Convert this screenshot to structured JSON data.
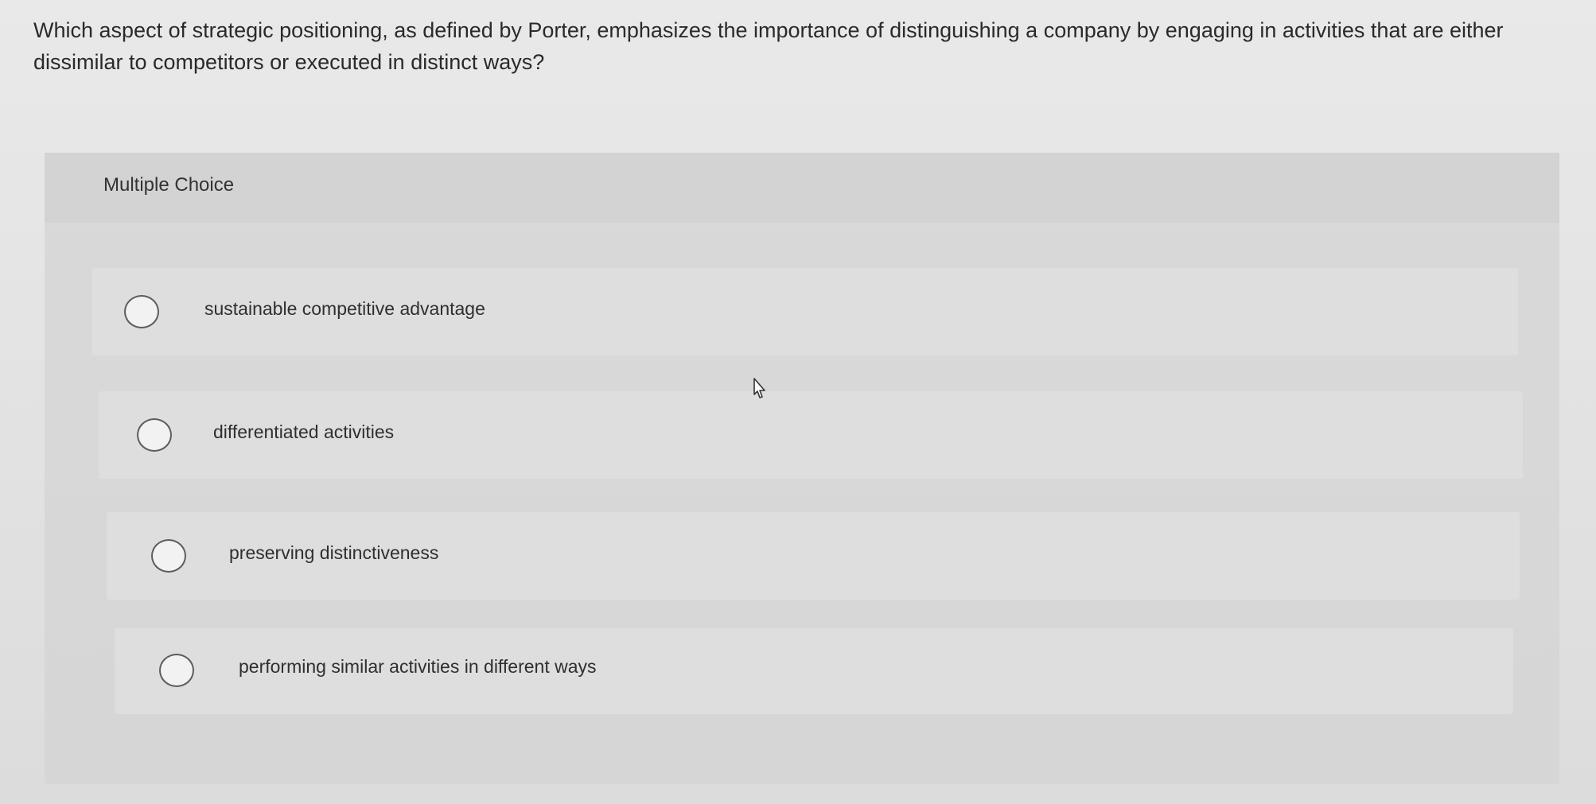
{
  "question": {
    "text": "Which aspect of strategic positioning, as defined by Porter, emphasizes the importance of distinguishing a company by engaging in activities that are either dissimilar to competitors or executed in distinct ways?"
  },
  "multiple_choice": {
    "label": "Multiple Choice",
    "options": [
      {
        "label": "sustainable competitive advantage",
        "selected": false
      },
      {
        "label": "differentiated activities",
        "selected": false
      },
      {
        "label": "preserving distinctiveness",
        "selected": false
      },
      {
        "label": "performing similar activities in different ways",
        "selected": false
      }
    ]
  },
  "icons": {
    "radio": "radio-unchecked-icon",
    "cursor": "hand-pointer-cursor-icon"
  }
}
